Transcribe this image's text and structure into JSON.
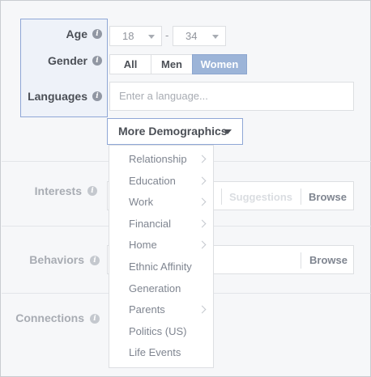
{
  "form": {
    "age": {
      "label": "Age",
      "min_value": "18",
      "max_value": "34",
      "separator": "-"
    },
    "gender": {
      "label": "Gender",
      "options": [
        "All",
        "Men",
        "Women"
      ],
      "selected": "Women"
    },
    "languages": {
      "label": "Languages",
      "placeholder": "Enter a language..."
    },
    "more_demographics": {
      "label": "More Demographics"
    },
    "interests": {
      "label": "Interests",
      "suggestions_label": "Suggestions",
      "browse_label": "Browse"
    },
    "behaviors": {
      "label": "Behaviors",
      "browse_label": "Browse"
    },
    "connections": {
      "label": "Connections"
    },
    "info_glyph": "i"
  },
  "demographics_menu": {
    "items": [
      {
        "label": "Relationship",
        "has_submenu": true
      },
      {
        "label": "Education",
        "has_submenu": true
      },
      {
        "label": "Work",
        "has_submenu": true
      },
      {
        "label": "Financial",
        "has_submenu": true
      },
      {
        "label": "Home",
        "has_submenu": true
      },
      {
        "label": "Ethnic Affinity",
        "has_submenu": false
      },
      {
        "label": "Generation",
        "has_submenu": false
      },
      {
        "label": "Parents",
        "has_submenu": true
      },
      {
        "label": "Politics (US)",
        "has_submenu": false
      },
      {
        "label": "Life Events",
        "has_submenu": false
      }
    ]
  },
  "colors": {
    "selected_segment": "#9cb4d8",
    "focus_border": "#8fa7d6",
    "label_text": "#4b4f56"
  }
}
